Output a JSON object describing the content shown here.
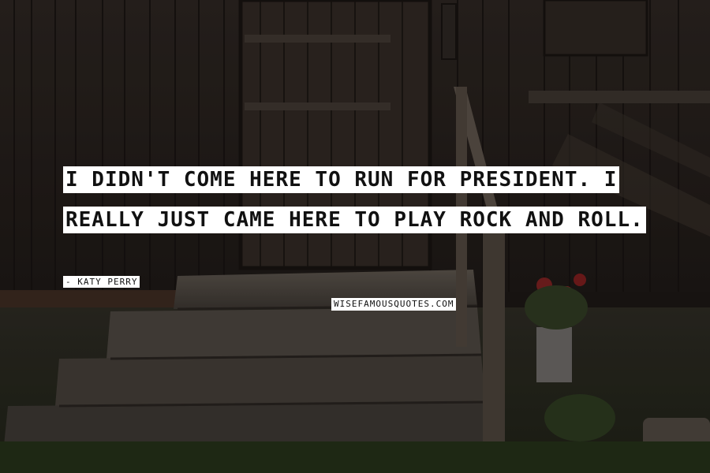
{
  "quote": {
    "text": "I DIDN'T COME HERE TO RUN FOR PRESIDENT. I REALLY JUST CAME HERE TO PLAY ROCK AND ROLL.",
    "author": "- KATY PERRY",
    "watermark": "WISEFAMOUSQUOTES.COM"
  },
  "colors": {
    "highlight": "#ffffff",
    "text": "#111111"
  }
}
